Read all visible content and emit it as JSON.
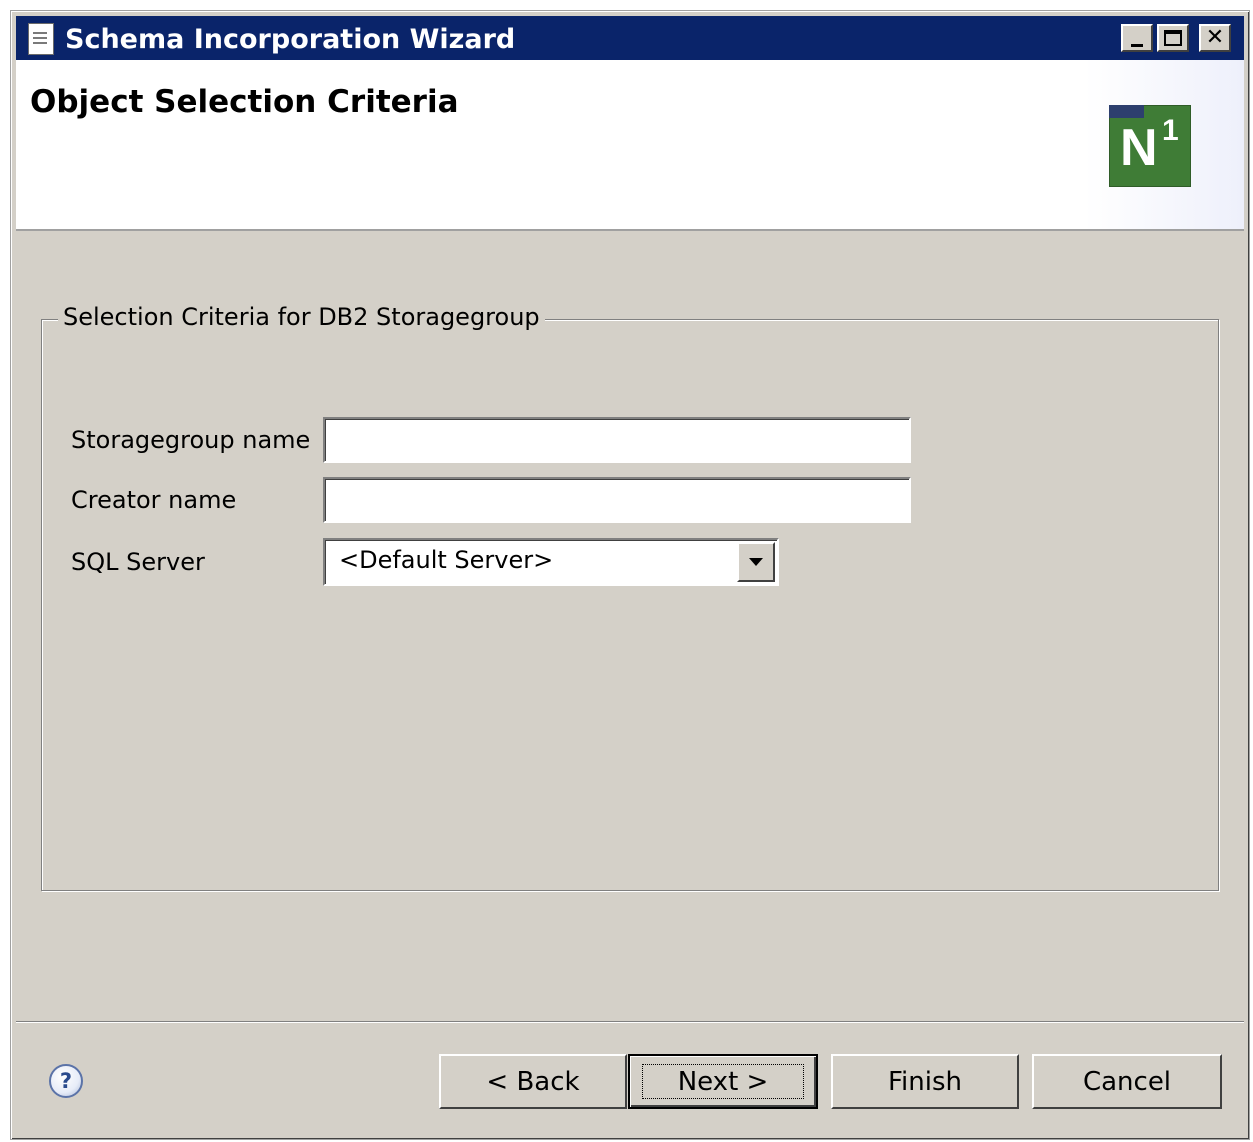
{
  "window": {
    "title": "Schema Incorporation Wizard"
  },
  "header": {
    "page_title": "Object Selection Criteria",
    "logo_letter": "N",
    "logo_superscript": "1"
  },
  "group": {
    "legend": "Selection Criteria for DB2 Storagegroup",
    "fields": {
      "storagegroup_label": "Storagegroup name",
      "storagegroup_value": "",
      "creator_label": "Creator name",
      "creator_value": "",
      "sqlserver_label": "SQL Server",
      "sqlserver_value": "<Default Server>"
    }
  },
  "footer": {
    "back_label": "< Back",
    "next_label": "Next >",
    "finish_label": "Finish",
    "cancel_label": "Cancel",
    "help_symbol": "?"
  },
  "icons": {
    "title_icon": "document-icon",
    "help_icon": "help-icon"
  }
}
